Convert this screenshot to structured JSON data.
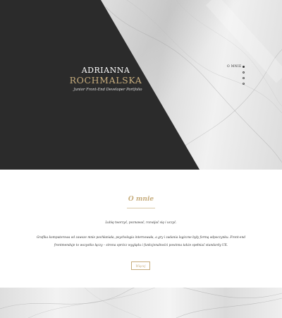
{
  "hero": {
    "first_name": "ADRIANNA",
    "last_name": "ROCHMALSKA",
    "tagline": "Junior Front-End Developer Portfolio"
  },
  "side_nav": {
    "items": [
      {
        "label": "O MNIE",
        "active": true
      },
      {
        "label": "",
        "active": false
      },
      {
        "label": "",
        "active": false
      },
      {
        "label": "",
        "active": false
      }
    ]
  },
  "about": {
    "title": "O mnie",
    "lead": "Lubię tworzyć, poznawać, rozwijać się i uczyć.",
    "body": "Grafika komputerowa od zawsze mnie pochłaniała, psychologia internowała, a gry i zadania logiczne były formą odpoczynku. Front-end frontmenduje to wszystko łączy – strona oprócz wyglądu i funkcjonalności powinna także spełniać standardy UX.",
    "button_label": "Więcej"
  },
  "colors": {
    "dark_panel": "#2b2b2b",
    "accent_gold": "#c7ad7d",
    "text": "#333333",
    "background": "#ffffff"
  }
}
